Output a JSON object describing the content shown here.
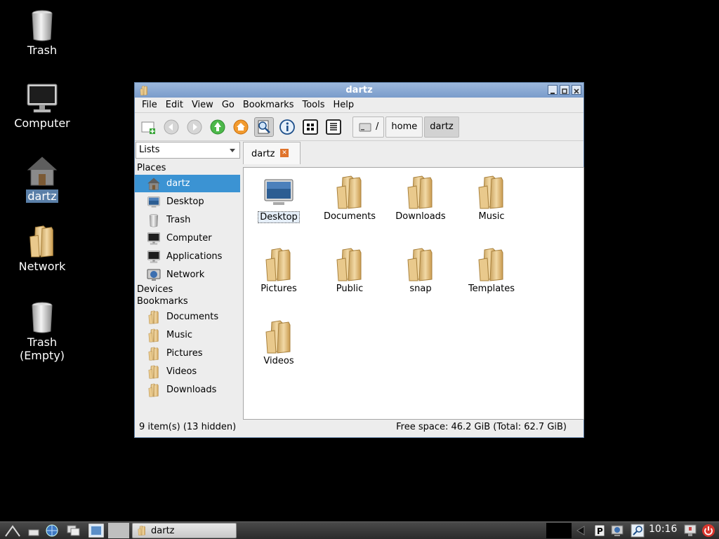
{
  "desktop": {
    "icons": [
      {
        "label": "Trash"
      },
      {
        "label": "Computer"
      },
      {
        "label": "dartz"
      },
      {
        "label": "Network"
      },
      {
        "label": "Trash\n(Empty)",
        "line1": "Trash",
        "line2": "(Empty)"
      }
    ]
  },
  "window": {
    "title": "dartz",
    "menu": [
      "File",
      "Edit",
      "View",
      "Go",
      "Bookmarks",
      "Tools",
      "Help"
    ],
    "menu_mnemonics": [
      "F",
      "E",
      "V",
      "G",
      "B",
      "T",
      "H"
    ],
    "toolbar": {
      "icons": [
        "new-tab-icon",
        "back-icon",
        "forward-icon",
        "up-icon",
        "home-icon",
        "search-icon",
        "info-icon",
        "icon-view-icon",
        "list-view-icon"
      ]
    },
    "path": [
      "/",
      "home",
      "dartz"
    ],
    "side_mode": "Lists",
    "sidebar": {
      "places_header": "Places",
      "places": [
        "dartz",
        "Desktop",
        "Trash",
        "Computer",
        "Applications",
        "Network"
      ],
      "devices_header": "Devices",
      "bookmarks_header": "Bookmarks",
      "bookmarks": [
        "Documents",
        "Music",
        "Pictures",
        "Videos",
        "Downloads"
      ]
    },
    "tab": {
      "label": "dartz"
    },
    "files": [
      "Desktop",
      "Documents",
      "Downloads",
      "Music",
      "Pictures",
      "Public",
      "snap",
      "Templates",
      "Videos"
    ],
    "status_left": "9 item(s) (13 hidden)",
    "status_right": "Free space: 46.2 GiB (Total: 62.7 GiB)"
  },
  "taskbar": {
    "task_label": "dartz",
    "clock": "10:16"
  },
  "colors": {
    "selection": "#3b93d3",
    "titlebar": "#8aaad4",
    "desktop": "#000000"
  }
}
